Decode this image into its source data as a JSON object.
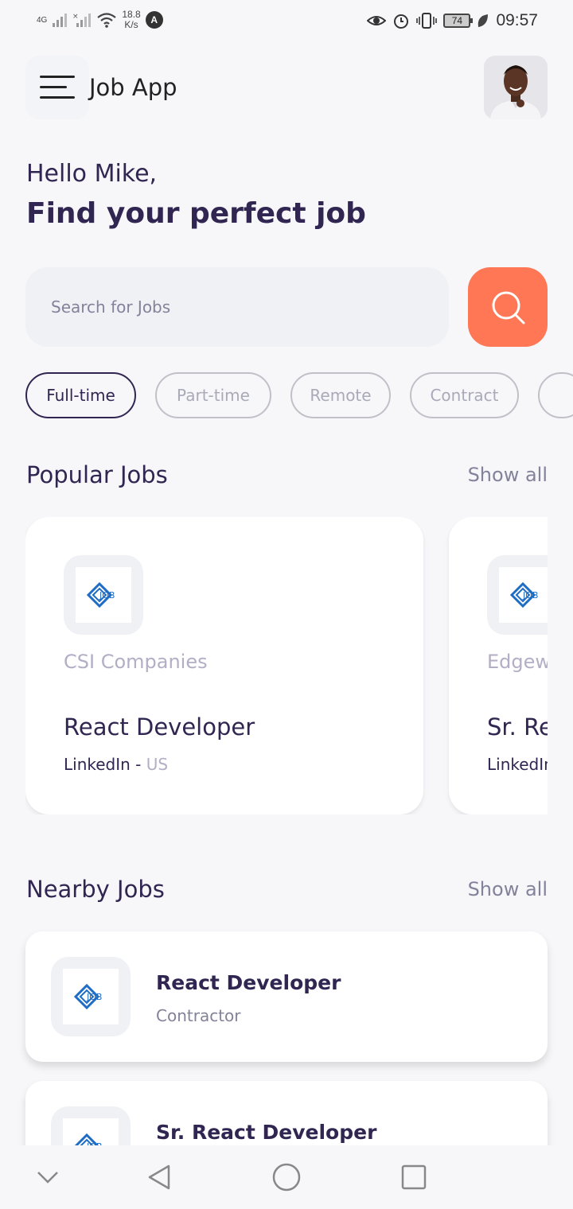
{
  "status_bar": {
    "network": "4G",
    "net_speed_value": "18.8",
    "net_speed_unit": "K/s",
    "battery": "74",
    "time": "09:57",
    "alert_icon_letter": "A"
  },
  "header": {
    "app_title": "Job App"
  },
  "welcome": {
    "greeting": "Hello Mike,",
    "headline": "Find your perfect job"
  },
  "search": {
    "placeholder": "Search for Jobs",
    "value": ""
  },
  "job_types": [
    "Full-time",
    "Part-time",
    "Remote",
    "Contract"
  ],
  "active_job_type": "Full-time",
  "popular": {
    "title": "Popular Jobs",
    "show_all": "Show all",
    "jobs": [
      {
        "company": "CSI Companies",
        "title": "React Developer",
        "publisher": "LinkedIn",
        "country": "US",
        "logo_text": "JOB"
      },
      {
        "company": "Edgewa",
        "title": "Sr. Re",
        "publisher": "LinkedIn",
        "country": "",
        "logo_text": "JOB"
      }
    ]
  },
  "nearby": {
    "title": "Nearby Jobs",
    "show_all": "Show all",
    "jobs": [
      {
        "title": "React Developer",
        "type": "Contractor",
        "logo_text": "JOB"
      },
      {
        "title": "Sr. React Developer",
        "type": "",
        "logo_text": "JOB"
      }
    ]
  },
  "colors": {
    "primary": "#312651",
    "accent": "#FF7754",
    "gray": "#83829A",
    "light_bg": "#F7F7FA"
  }
}
